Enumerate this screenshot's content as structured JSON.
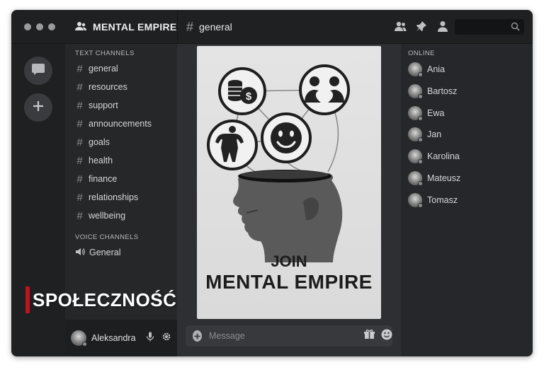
{
  "server": {
    "name": "MENTAL EMPIRE"
  },
  "current_channel": {
    "name": "general"
  },
  "sidebar": {
    "text_category": "TEXT CHANNELS",
    "text_channels": [
      {
        "label": "general"
      },
      {
        "label": "resources"
      },
      {
        "label": "support"
      },
      {
        "label": "announcements"
      },
      {
        "label": "goals"
      },
      {
        "label": "health"
      },
      {
        "label": "finance"
      },
      {
        "label": "relationships"
      },
      {
        "label": "wellbeing"
      }
    ],
    "voice_category": "VOICE CHANNELS",
    "voice_channels": [
      {
        "label": "General"
      }
    ]
  },
  "user": {
    "name": "Aleksandra"
  },
  "poster": {
    "line1": "JOIN",
    "line2": "MENTAL EMPIRE"
  },
  "composer": {
    "placeholder": "Message"
  },
  "members": {
    "header": "ONLINE",
    "list": [
      {
        "name": "Ania"
      },
      {
        "name": "Bartosz"
      },
      {
        "name": "Ewa"
      },
      {
        "name": "Jan"
      },
      {
        "name": "Karolina"
      },
      {
        "name": "Mateusz"
      },
      {
        "name": "Tomasz"
      }
    ]
  },
  "overlay": {
    "text": "SPOŁECZNOŚĆ"
  },
  "colors": {
    "accent": "#c1121f",
    "background": "#2b2c2f",
    "sidebar": "#262729"
  },
  "icons": [
    "members-icon",
    "pin-icon",
    "user-icon",
    "search-icon",
    "chat-icon",
    "plus-icon",
    "hash-icon",
    "speaker-icon",
    "mic-icon",
    "gear-icon",
    "gift-icon",
    "emoji-icon"
  ]
}
